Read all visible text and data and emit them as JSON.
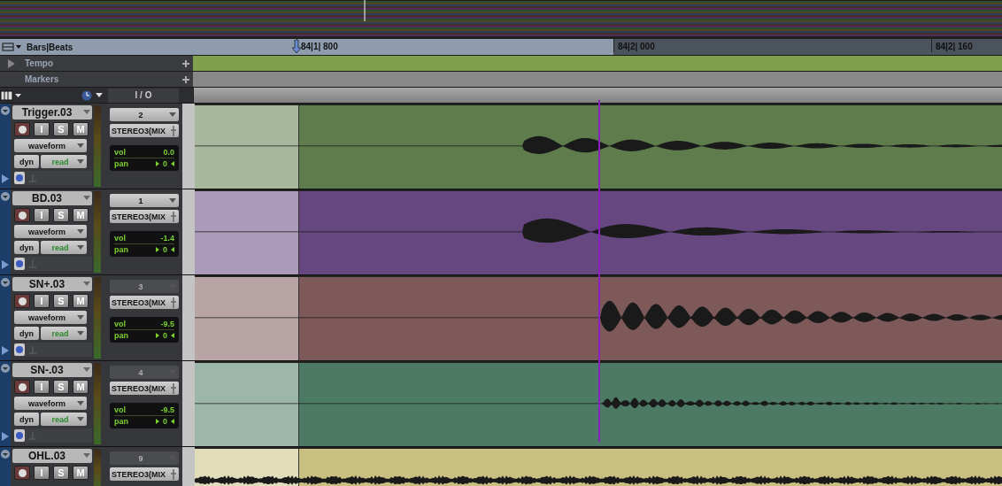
{
  "ruler": {
    "label": "Bars|Beats",
    "ticks": [
      "84|1| 800",
      "84|2| 000",
      "84|2| 160"
    ]
  },
  "rows": [
    {
      "label": "Tempo",
      "expandable": true
    },
    {
      "label": "Markers",
      "expandable": false
    }
  ],
  "io_header": "I / O",
  "tracks": [
    {
      "name": "Trigger.03",
      "buttons": [
        "I",
        "S",
        "M"
      ],
      "view": "waveform",
      "dyn": "dyn",
      "automation": "read",
      "input": "2",
      "input_disabled": false,
      "output": "STEREO3(MIX",
      "vol_label": "vol",
      "vol": "0.0",
      "pan_label": "pan",
      "pan": "0",
      "color": "#5f7d4c"
    },
    {
      "name": "BD.03",
      "buttons": [
        "I",
        "S",
        "M"
      ],
      "view": "waveform",
      "dyn": "dyn",
      "automation": "read",
      "input": "1",
      "input_disabled": false,
      "output": "STEREO3(MIX",
      "vol_label": "vol",
      "vol": "-1.4",
      "pan_label": "pan",
      "pan": "0",
      "color": "#67477f"
    },
    {
      "name": "SN+.03",
      "buttons": [
        "I",
        "S",
        "M"
      ],
      "view": "waveform",
      "dyn": "dyn",
      "automation": "read",
      "input": "3",
      "input_disabled": true,
      "output": "STEREO3(MIX",
      "vol_label": "vol",
      "vol": "-9.5",
      "pan_label": "pan",
      "pan": "0",
      "color": "#7e5959"
    },
    {
      "name": "SN-.03",
      "buttons": [
        "I",
        "S",
        "M"
      ],
      "view": "waveform",
      "dyn": "dyn",
      "automation": "read",
      "input": "4",
      "input_disabled": true,
      "output": "STEREO3(MIX",
      "vol_label": "vol",
      "vol": "-9.5",
      "pan_label": "pan",
      "pan": "0",
      "color": "#4d7a64"
    },
    {
      "name": "OHL.03",
      "buttons": [
        "I",
        "S",
        "M"
      ],
      "input": "9",
      "input_disabled": true,
      "output": "STEREO3(MIX",
      "color": "#c9bf80"
    }
  ]
}
